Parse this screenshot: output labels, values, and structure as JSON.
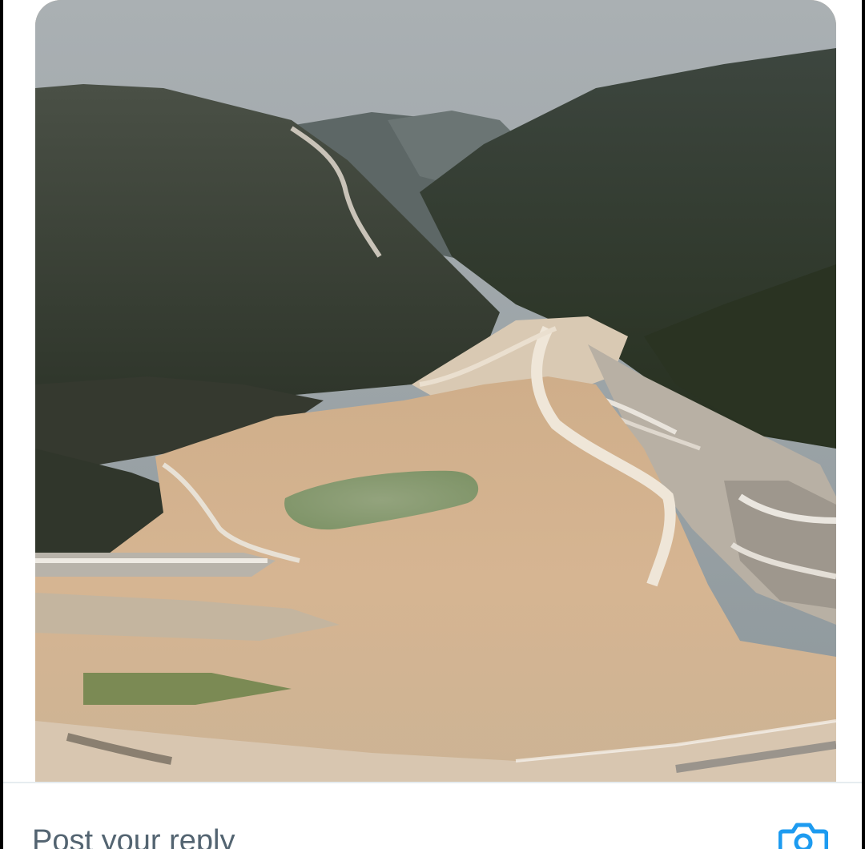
{
  "tweet": {
    "media": {
      "icon": "dry-reservoir-photo"
    }
  },
  "reply": {
    "placeholder": "Post your reply",
    "camera_icon": "camera-icon"
  },
  "colors": {
    "background": "#000000",
    "surface": "#ffffff",
    "accent": "#1d9bf0",
    "placeholder_text": "#536471",
    "divider": "#e6ecf0"
  }
}
